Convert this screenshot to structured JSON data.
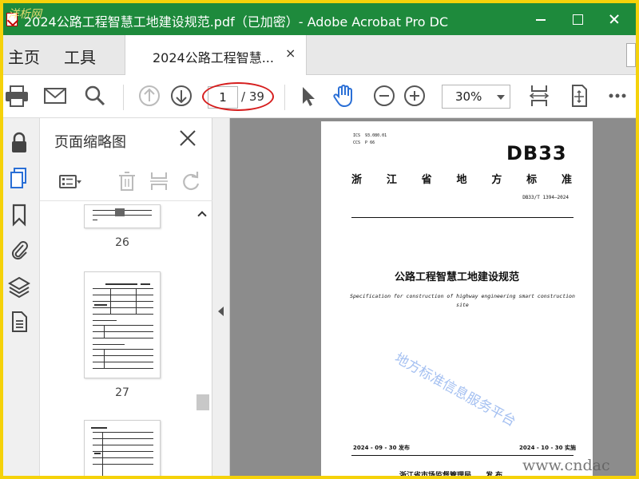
{
  "window": {
    "title": "2024公路工程智慧工地建设规范.pdf（已加密）- Adobe Acrobat Pro DC",
    "corner_watermark": "洋析网"
  },
  "menu": {
    "home": "主页",
    "tools": "工具"
  },
  "tab": {
    "label": "2024公路工程智慧...",
    "close": "×"
  },
  "toolbar": {
    "icons": [
      "print-icon",
      "email-icon",
      "search-icon",
      "prev-page-icon",
      "next-page-icon",
      "select-pointer-icon",
      "hand-tool-icon",
      "zoom-out-icon",
      "zoom-in-icon",
      "fit-page-icon",
      "full-screen-icon",
      "more-icon"
    ],
    "current_page": "1",
    "total_pages": "/ 39",
    "zoom": "30%"
  },
  "rail": {
    "icons": [
      "lock-icon",
      "pages-icon",
      "bookmark-icon",
      "attachment-icon",
      "layers-icon",
      "document-icon"
    ]
  },
  "panel": {
    "title": "页面缩略图",
    "thumbnails": [
      {
        "label": "26"
      },
      {
        "label": "27"
      },
      {
        "label": ""
      }
    ]
  },
  "document": {
    "ics_lines": "ICS  93.080.01\nCCS  P 66",
    "db_code": "DB33",
    "province_chars": [
      "浙",
      "江",
      "省",
      "地",
      "方",
      "标",
      "准"
    ],
    "standard_no": "DB33/T 1394—2024",
    "title_cn": "公路工程智慧工地建设规范",
    "title_en": "Specification for construction of highway engineering smart construction site",
    "watermark": "地方标准信息服务平台",
    "issue_date": "2024 - 09 - 30 发布",
    "impl_date": "2024 - 10 - 30 实施",
    "issuer": "浙江省市场监督管理局　　发 布"
  },
  "site_watermark": "www.cndac",
  "colors": {
    "titlebar": "#1e8a3c",
    "highlight": "#d61e1e",
    "hand_tool": "#2a6fd6",
    "frame": "#f5d20a"
  }
}
